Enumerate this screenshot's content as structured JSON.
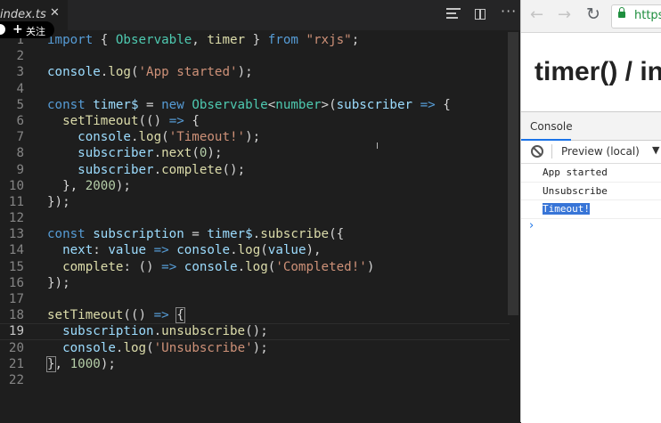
{
  "editor": {
    "tab_title": "index.ts",
    "tab_close": "✕",
    "follow_badge": {
      "plus": "+",
      "label": "关注"
    },
    "more": "···",
    "lines": [
      {
        "n": "1",
        "html": "<span class=\"kw\">import</span> { <span class=\"ty\">Observable</span>, <span class=\"fn\">timer</span> } <span class=\"kw\">from</span> <span class=\"str\">\"rxjs\"</span>;"
      },
      {
        "n": "2",
        "html": ""
      },
      {
        "n": "3",
        "html": "<span class=\"var\">console</span>.<span class=\"fn\">log</span>(<span class=\"str\">'App started'</span>);"
      },
      {
        "n": "4",
        "html": ""
      },
      {
        "n": "5",
        "html": "<span class=\"kw\">const</span> <span class=\"var\">timer$</span> = <span class=\"kw\">new</span> <span class=\"ty\">Observable</span>&lt;<span class=\"ty\">number</span>&gt;(<span class=\"var\">subscriber</span> <span class=\"kw\">=&gt;</span> {"
      },
      {
        "n": "6",
        "html": "  <span class=\"fn\">setTimeout</span>(() <span class=\"kw\">=&gt;</span> {"
      },
      {
        "n": "7",
        "html": "    <span class=\"var\">console</span>.<span class=\"fn\">log</span>(<span class=\"str\">'Timeout!'</span>);"
      },
      {
        "n": "8",
        "html": "    <span class=\"var\">subscriber</span>.<span class=\"fn\">next</span>(<span class=\"num\">0</span>);"
      },
      {
        "n": "9",
        "html": "    <span class=\"var\">subscriber</span>.<span class=\"fn\">complete</span>();"
      },
      {
        "n": "10",
        "html": "  }, <span class=\"num\">2000</span>);"
      },
      {
        "n": "11",
        "html": "});"
      },
      {
        "n": "12",
        "html": ""
      },
      {
        "n": "13",
        "html": "<span class=\"kw\">const</span> <span class=\"var\">subscription</span> = <span class=\"var\">timer$</span>.<span class=\"fn\">subscribe</span>({"
      },
      {
        "n": "14",
        "html": "  <span class=\"var\">next</span>: <span class=\"var\">value</span> <span class=\"kw\">=&gt;</span> <span class=\"var\">console</span>.<span class=\"fn\">log</span>(<span class=\"var\">value</span>),"
      },
      {
        "n": "15",
        "html": "  <span class=\"fn\">complete</span>: () <span class=\"kw\">=&gt;</span> <span class=\"var\">console</span>.<span class=\"fn\">log</span>(<span class=\"str\">'Completed!'</span>)"
      },
      {
        "n": "16",
        "html": "});"
      },
      {
        "n": "17",
        "html": ""
      },
      {
        "n": "18",
        "html": "<span class=\"fn\">setTimeout</span>(() <span class=\"kw\">=&gt;</span> <span class=\"br\">{</span>"
      },
      {
        "n": "19",
        "html": "  <span class=\"var\">subscription</span>.<span class=\"fn\">unsubscribe</span>();",
        "current": true
      },
      {
        "n": "20",
        "html": "  <span class=\"var\">console</span>.<span class=\"fn\">log</span>(<span class=\"str\">'Unsubscribe'</span>);"
      },
      {
        "n": "21",
        "html": "<span class=\"br\">}</span>, <span class=\"num\">1000</span>);"
      },
      {
        "n": "22",
        "html": ""
      }
    ]
  },
  "browser": {
    "back": "←",
    "forward": "→",
    "reload": "↻",
    "url": "https",
    "page_heading": "timer() / in",
    "devtools": {
      "tab": "Console",
      "context": "Preview (local)",
      "context_arrow": "▼",
      "log": [
        {
          "text": "App started",
          "selected": false
        },
        {
          "text": "Unsubscribe",
          "selected": false
        },
        {
          "text": "Timeout!",
          "selected": true
        }
      ],
      "prompt": "›"
    }
  }
}
